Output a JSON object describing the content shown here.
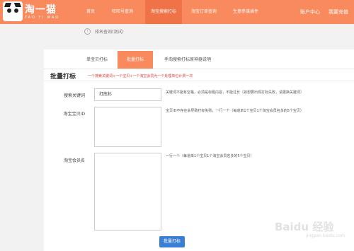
{
  "header": {
    "logo_text": "淘一猫",
    "logo_sub": "TAO YI MAO",
    "nav": [
      {
        "label": "首页"
      },
      {
        "label": "旺旺号查询"
      },
      {
        "label": "淘宝搜索打标"
      },
      {
        "label": "淘宝订单查询"
      },
      {
        "label": "生意参谋插件"
      }
    ],
    "account_center": "账户中心",
    "my_profile": "我要充值"
  },
  "notice": {
    "icon": "info-icon",
    "text": "排名查询(测试)"
  },
  "tabs": [
    {
      "label": "单宝贝打标"
    },
    {
      "label": "批量打标"
    },
    {
      "label": "手淘搜索打标原神器说明"
    }
  ],
  "form": {
    "title": "批量打标",
    "hint": "一个搜索关键词+一个宝贝+一个淘宝会员为一个处理单位计费一次",
    "keyword_label": "搜索关键词",
    "keyword_value": "打底衫",
    "keyword_help": "关键词不能有空格，必须是标题内容，不能过长（如想要出现打标失败，请更换关键词）",
    "item_id_label": "淘宝宝贝ID",
    "item_id_help": "宝贝ID不存在会导致打标失败，一行一个（每道单1个宝贝1个淘宝会员名多的5个宝贝）",
    "member_label": "淘宝会员名",
    "member_help": "一行一个（每道单1个宝贝1个淘宝会员名多的5个宝贝）",
    "submit_label": "批量打标"
  },
  "watermark": {
    "text": "Baidu 经验",
    "sub": "jingyan.baidu.com"
  },
  "colors": {
    "header": "#f98a5e",
    "active_tab": "#f98a5e",
    "submit": "#3a7fd5",
    "hint": "#e03a3a"
  }
}
